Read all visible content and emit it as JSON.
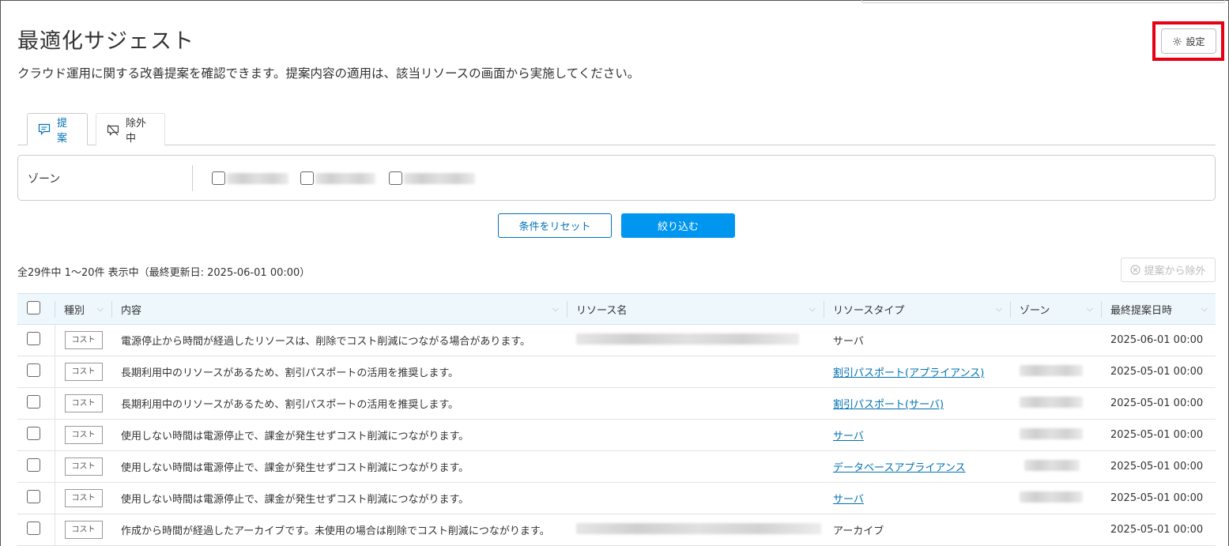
{
  "page": {
    "title": "最適化サジェスト",
    "description": "クラウド運用に関する改善提案を確認できます。提案内容の適用は、該当リソースの画面から実施してください。",
    "settings_label": "設定"
  },
  "tabs": [
    {
      "label": "提案",
      "icon": "comment-icon",
      "active": true
    },
    {
      "label": "除外中",
      "icon": "eye-off-icon",
      "active": false
    }
  ],
  "filter": {
    "label": "ゾーン",
    "reset_label": "条件をリセット",
    "apply_label": "絞り込む"
  },
  "summary": {
    "count_text": "全29件中 1～20件 表示中（最終更新日: 2025-06-01 00:00）",
    "exclude_label": "提案から除外"
  },
  "table": {
    "columns": [
      "種別",
      "内容",
      "リソース名",
      "リソースタイプ",
      "ゾーン",
      "最終提案日時"
    ],
    "rows": [
      {
        "type": "コスト",
        "content": "電源停止から時間が経過したリソースは、削除でコスト削減につながる場合があります。",
        "resource_type": "サーバ",
        "resource_type_link": false,
        "date": "2025-06-01 00:00"
      },
      {
        "type": "コスト",
        "content": "長期利用中のリソースがあるため、割引パスポートの活用を推奨します。",
        "resource_type": "割引パスポート(アプライアンス)",
        "resource_type_link": true,
        "date": "2025-05-01 00:00"
      },
      {
        "type": "コスト",
        "content": "長期利用中のリソースがあるため、割引パスポートの活用を推奨します。",
        "resource_type": "割引パスポート(サーバ)",
        "resource_type_link": true,
        "date": "2025-05-01 00:00"
      },
      {
        "type": "コスト",
        "content": "使用しない時間は電源停止で、課金が発生せずコスト削減につながります。",
        "resource_type": "サーバ",
        "resource_type_link": true,
        "date": "2025-05-01 00:00"
      },
      {
        "type": "コスト",
        "content": "使用しない時間は電源停止で、課金が発生せずコスト削減につながります。",
        "resource_type": "データベースアプライアンス",
        "resource_type_link": true,
        "date": "2025-05-01 00:00"
      },
      {
        "type": "コスト",
        "content": "使用しない時間は電源停止で、課金が発生せずコスト削減につながります。",
        "resource_type": "サーバ",
        "resource_type_link": true,
        "date": "2025-05-01 00:00"
      },
      {
        "type": "コスト",
        "content": "作成から時間が経過したアーカイブです。未使用の場合は削除でコスト削減につながります。",
        "resource_type": "アーカイブ",
        "resource_type_link": false,
        "date": "2025-05-01 00:00"
      }
    ]
  },
  "colors": {
    "accent": "#0071b3",
    "primary_button": "#0096f0",
    "highlight": "#e60012"
  }
}
